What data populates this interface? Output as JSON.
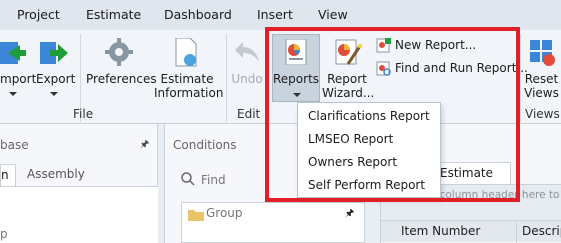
{
  "menu": {
    "items": [
      "Project",
      "Estimate",
      "Dashboard",
      "Insert",
      "View"
    ]
  },
  "ribbon": {
    "import_label": "mport",
    "export_label": "Export",
    "preferences_label": "Preferences",
    "estimate_info_label_1": "Estimate",
    "estimate_info_label_2": "Information",
    "undo_label": "Undo",
    "reports_label": "Reports",
    "report_wizard_label_1": "Report",
    "report_wizard_label_2": "Wizard...",
    "new_report_label": "New Report...",
    "find_run_report_label": "Find and Run Report...",
    "reset_views_label_1": "Reset",
    "reset_views_label_2": "Views",
    "groups": {
      "file": "File",
      "edit": "Edit",
      "views": "Views"
    }
  },
  "dropdown": {
    "items": [
      "Clarifications Report",
      "LMSEO Report",
      "Owners Report",
      "Self Perform Report"
    ]
  },
  "left_panel": {
    "title": "base",
    "tab_active": "n",
    "tab_assembly": "Assembly",
    "bottom_text": "p"
  },
  "conditions_panel": {
    "title": "Conditions",
    "find_placeholder": "Find",
    "group_label": "Group"
  },
  "estimate_panel": {
    "tab_label": "Estimate",
    "drag_hint": "Drag a column header here to gr",
    "col_item_number": "Item Number",
    "col_description": "Descrip"
  },
  "colors": {
    "highlight": "#e01f26",
    "ribbon_bg": "#f1f4f8",
    "menubar_bg": "#dfe6ee"
  }
}
